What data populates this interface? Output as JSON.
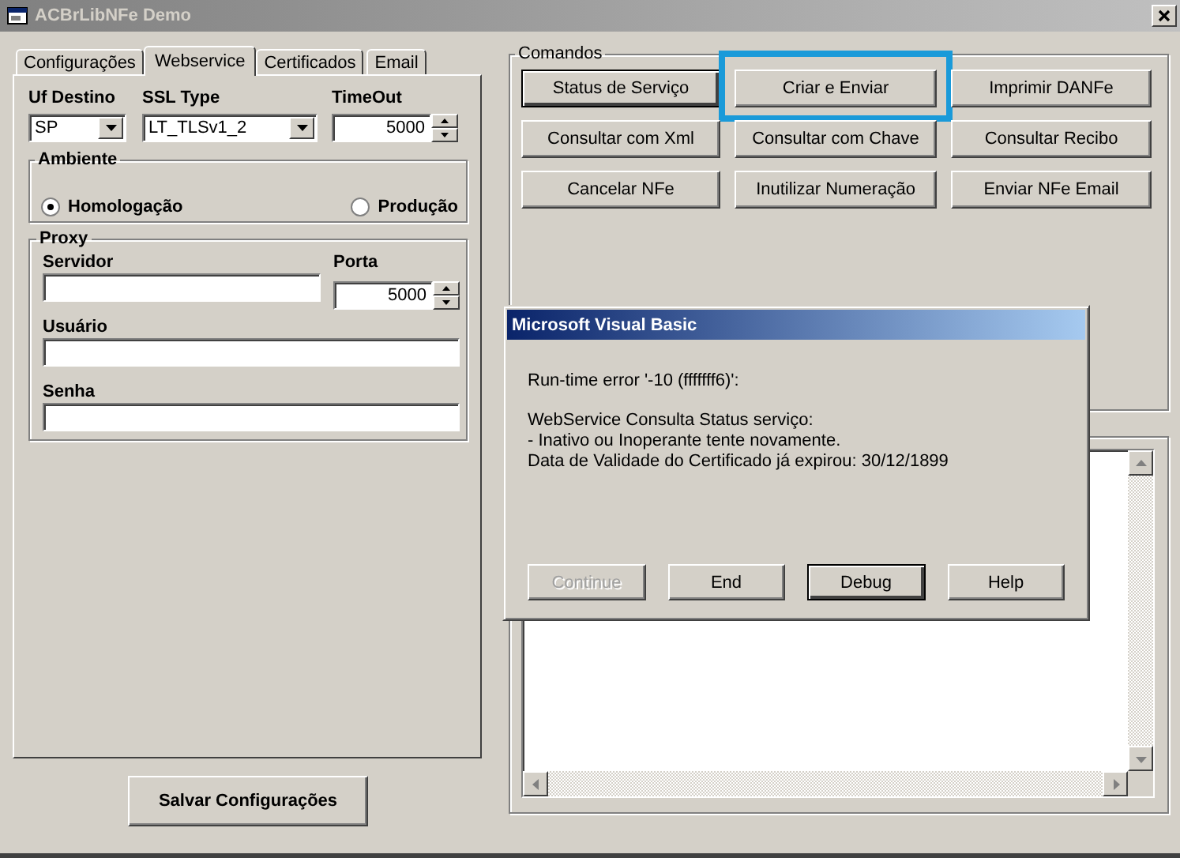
{
  "window": {
    "title": "ACBrLibNFe Demo"
  },
  "tabs": [
    {
      "label": "Configurações",
      "selected": false
    },
    {
      "label": "Webservice",
      "selected": true
    },
    {
      "label": "Certificados",
      "selected": false
    },
    {
      "label": "Email",
      "selected": false
    }
  ],
  "webservice": {
    "uf_destino": {
      "label": "Uf Destino",
      "value": "SP"
    },
    "ssl_type": {
      "label": "SSL Type",
      "value": "LT_TLSv1_2"
    },
    "timeout": {
      "label": "TimeOut",
      "value": "5000"
    }
  },
  "ambiente": {
    "title": "Ambiente",
    "options": [
      {
        "label": "Homologação",
        "selected": true
      },
      {
        "label": "Produção",
        "selected": false
      }
    ]
  },
  "proxy": {
    "title": "Proxy",
    "servidor": {
      "label": "Servidor"
    },
    "porta": {
      "label": "Porta",
      "value": "5000"
    },
    "usuario": {
      "label": "Usuário"
    },
    "senha": {
      "label": "Senha"
    }
  },
  "save_button": "Salvar Configurações",
  "comandos": {
    "title": "Comandos",
    "buttons": [
      {
        "label": "Status de Serviço",
        "default": true,
        "highlighted": false
      },
      {
        "label": "Criar e Enviar",
        "default": false,
        "highlighted": true
      },
      {
        "label": "Imprimir DANFe",
        "default": false,
        "highlighted": false
      },
      {
        "label": "Consultar com Xml",
        "default": false,
        "highlighted": false
      },
      {
        "label": "Consultar com Chave",
        "default": false,
        "highlighted": false
      },
      {
        "label": "Consultar Recibo",
        "default": false,
        "highlighted": false
      },
      {
        "label": "Cancelar NFe",
        "default": false,
        "highlighted": false
      },
      {
        "label": "Inutilizar Numeração",
        "default": false,
        "highlighted": false
      },
      {
        "label": "Enviar NFe Email",
        "default": false,
        "highlighted": false
      }
    ]
  },
  "dialog": {
    "title": "Microsoft Visual Basic",
    "error": "Run-time error '-10 (fffffff6)':",
    "message": [
      "WebService Consulta Status serviço:",
      "- Inativo ou Inoperante tente novamente.",
      "Data de Validade do Certificado já expirou: 30/12/1899"
    ],
    "buttons": [
      {
        "label": "Continue",
        "disabled": true,
        "default": false
      },
      {
        "label": "End",
        "disabled": false,
        "default": false
      },
      {
        "label": "Debug",
        "disabled": false,
        "default": true
      },
      {
        "label": "Help",
        "disabled": false,
        "default": false
      }
    ]
  }
}
